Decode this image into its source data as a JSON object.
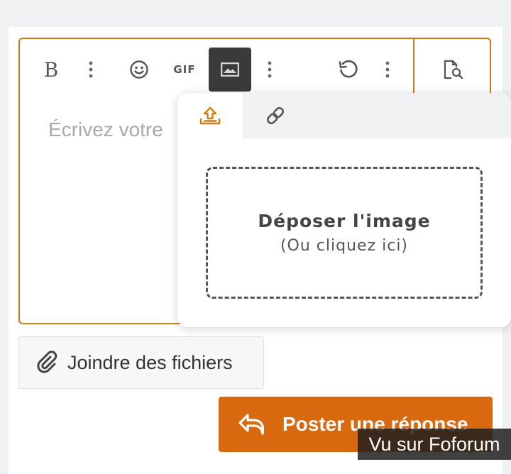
{
  "editor": {
    "placeholder": "Écrivez votre",
    "toolbar": {
      "bold_label": "B",
      "gif_label": "GIF",
      "icons": [
        "bold-icon",
        "more-vertical-icon",
        "emoji-icon",
        "gif-icon",
        "image-icon",
        "more-vertical-icon",
        "undo-icon",
        "more-vertical-icon",
        "preview-icon"
      ]
    }
  },
  "image_popup": {
    "tabs": [
      {
        "name": "upload-tab",
        "icon": "upload-icon",
        "active": true
      },
      {
        "name": "link-tab",
        "icon": "link-icon",
        "active": false
      }
    ],
    "dropzone_title": "Déposer l'image",
    "dropzone_subtitle": "(Ou cliquez ici)"
  },
  "attach_button": {
    "label": "Joindre des fichiers",
    "icon": "paperclip-icon"
  },
  "post_button": {
    "label": "Poster une réponse",
    "icon": "reply-icon"
  },
  "watermark": "Vu sur Foforum",
  "colors": {
    "accent": "#d9690f",
    "border": "#d07a12",
    "active_tool": "#3a3a3c",
    "background": "#f0f1f3"
  }
}
